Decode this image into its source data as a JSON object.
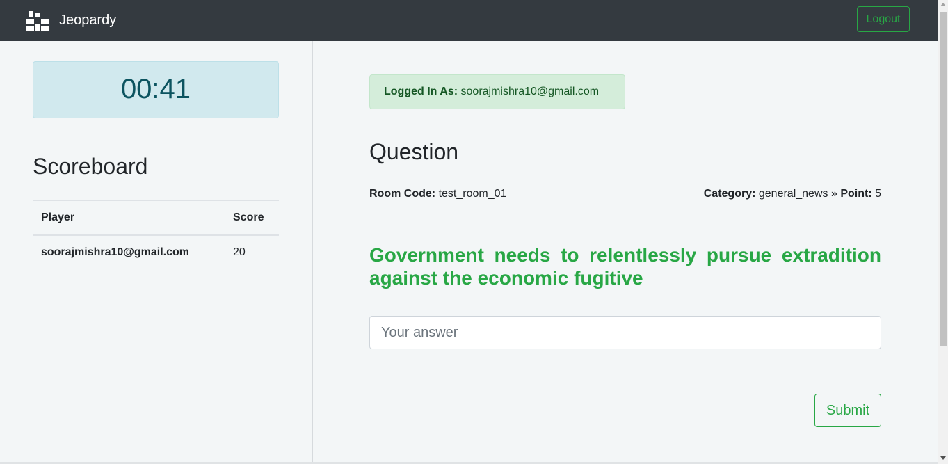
{
  "navbar": {
    "brand": "Jeopardy",
    "brand_icon": "boxes-icon",
    "logout_label": "Logout"
  },
  "timer": {
    "value": "00:41"
  },
  "scoreboard": {
    "title": "Scoreboard",
    "columns": [
      "Player",
      "Score"
    ],
    "rows": [
      {
        "player": "soorajmishra10@gmail.com",
        "score": "20"
      }
    ]
  },
  "session": {
    "logged_label": "Logged In As:",
    "email": "soorajmishra10@gmail.com"
  },
  "question": {
    "title": "Question",
    "room_label": "Room Code:",
    "room_code": "test_room_01",
    "category_label": "Category:",
    "category": "general_news",
    "separator": "»",
    "point_label": "Point:",
    "point": "5",
    "text": "Government needs to relentlessly pursue extradition against the economic fugitive"
  },
  "answer": {
    "placeholder": "Your answer",
    "value": ""
  },
  "submit_label": "Submit",
  "colors": {
    "navbar": "#343a40",
    "success": "#28a745",
    "timer_bg": "#d1e9ee",
    "timer_text": "#0c5460",
    "alert_bg": "#d4edda",
    "alert_text": "#155724"
  }
}
